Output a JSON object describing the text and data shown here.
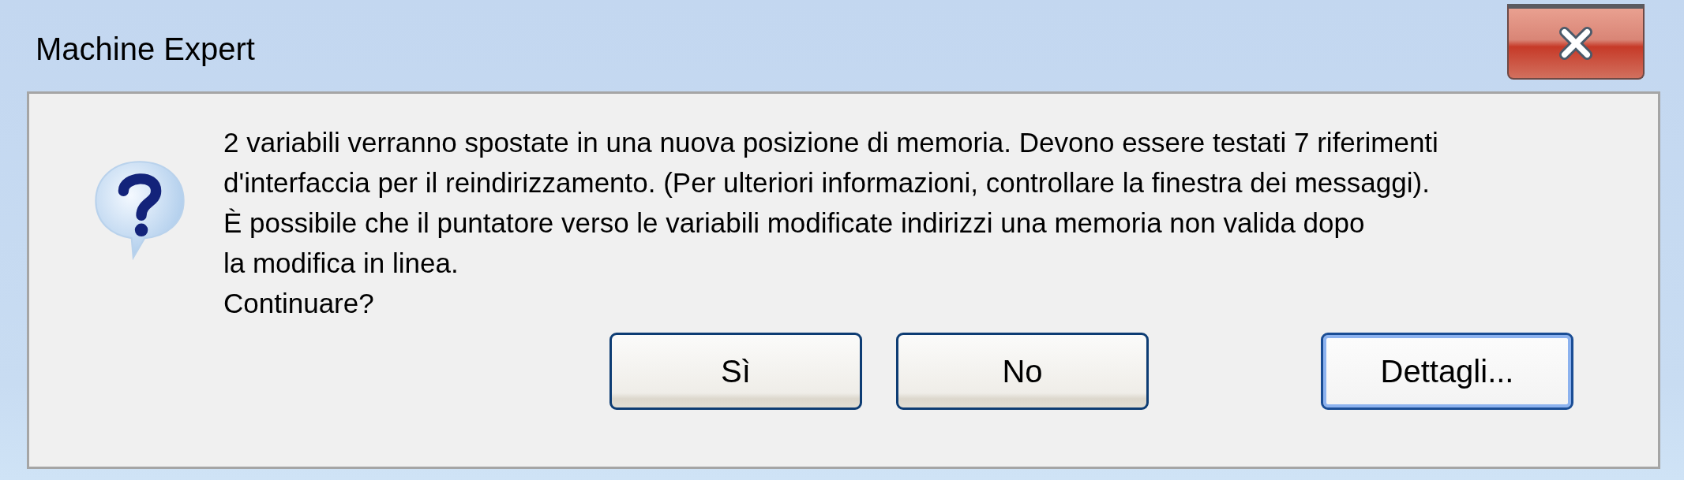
{
  "window": {
    "title": "Machine Expert"
  },
  "message": {
    "lines": [
      "2 variabili verranno spostate in una nuova posizione di memoria. Devono essere testati 7 riferimenti",
      "d'interfaccia per il reindirizzamento. (Per ulteriori informazioni, controllare la finestra dei messaggi).",
      "È possibile che il puntatore verso le variabili modificate indirizzi una memoria non valida dopo",
      "la modifica in linea.",
      "Continuare?"
    ]
  },
  "buttons": [
    {
      "label": "Sì",
      "default": false
    },
    {
      "label": "No",
      "default": false
    },
    {
      "label": "Dettagli...",
      "default": true
    }
  ]
}
